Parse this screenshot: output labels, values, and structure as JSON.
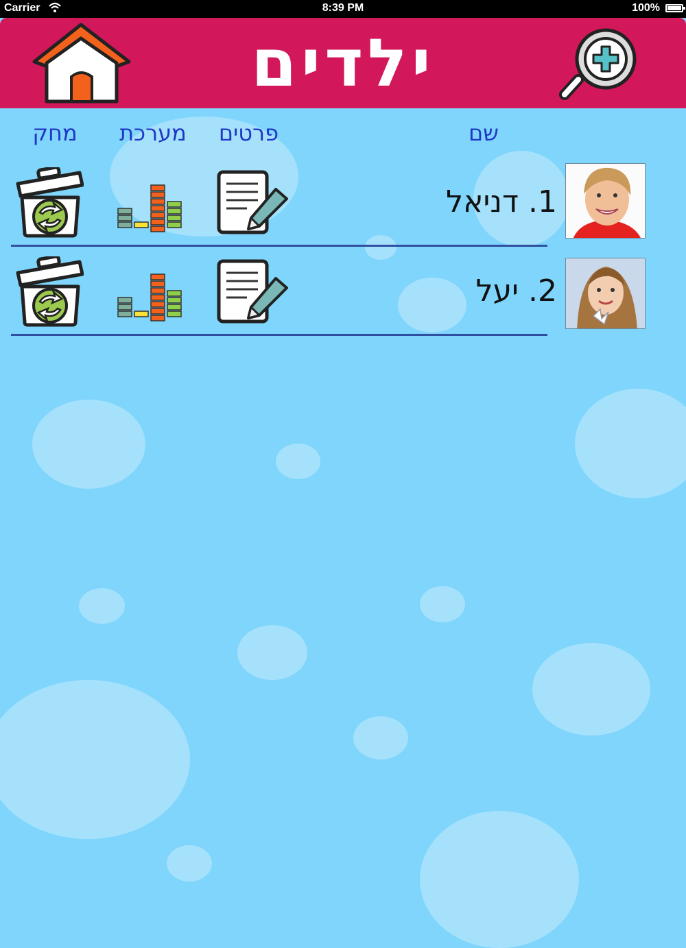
{
  "status_bar": {
    "carrier": "Carrier",
    "time": "8:39 PM",
    "battery": "100%"
  },
  "header": {
    "title": "ילדים",
    "home_icon": "home-icon",
    "add_icon": "magnifier-plus-icon"
  },
  "columns": {
    "name": "שם",
    "details": "פרטים",
    "system": "מערכת",
    "delete": "מחק"
  },
  "children": [
    {
      "label": "1. דניאל"
    },
    {
      "label": "2. יעל"
    }
  ],
  "colors": {
    "header": "#d2175a",
    "background": "#7fd5fb",
    "column_text": "#1f38c6",
    "divider": "#2f4fa0"
  }
}
